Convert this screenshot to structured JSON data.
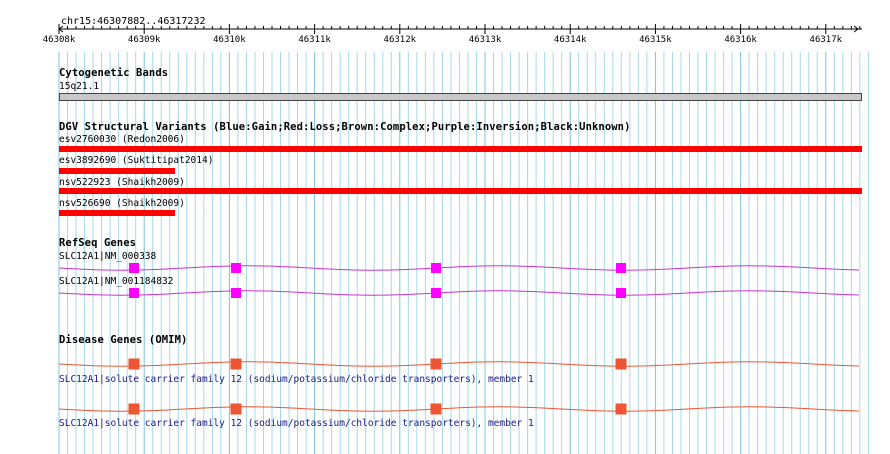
{
  "region": "chr15:46307882..46317232",
  "ruler": {
    "ticks": [
      "46308k",
      "46309k",
      "46310k",
      "46311k",
      "46312k",
      "46313k",
      "46314k",
      "46315k",
      "46316k",
      "46317k"
    ]
  },
  "colors": {
    "grid_line": "#a8d8e8",
    "sv_loss": "#ff0000",
    "refseq": "#cc33cc",
    "refseq_exon": "#ff00ff",
    "omim": "#ee5533",
    "omim_label": "#1a1a8c",
    "band": "#c8c8c8"
  },
  "tracks": {
    "cyto": {
      "title": "Cytogenetic Bands",
      "band_label": "15q21.1"
    },
    "dgv": {
      "title": "DGV Structural Variants (Blue:Gain;Red:Loss;Brown:Complex;Purple:Inversion;Black:Unknown)",
      "items": [
        {
          "label": "esv2760030 (Redon2006)",
          "span": "full"
        },
        {
          "label": "esv3892690 (Suktitipat2014)",
          "span": "short"
        },
        {
          "label": "nsv522923 (Shaikh2009)",
          "span": "full"
        },
        {
          "label": "nsv526690 (Shaikh2009)",
          "span": "short"
        }
      ]
    },
    "refseq": {
      "title": "RefSeq Genes",
      "items": [
        {
          "label": "SLC12A1|NM_000338"
        },
        {
          "label": "SLC12A1|NM_001184832"
        }
      ]
    },
    "omim": {
      "title": "Disease Genes (OMIM)",
      "items": [
        {
          "label": "SLC12A1|solute carrier family 12 (sodium/potassium/chloride transporters), member 1"
        },
        {
          "label": "SLC12A1|solute carrier family 12 (sodium/potassium/chloride transporters), member 1"
        }
      ]
    }
  }
}
